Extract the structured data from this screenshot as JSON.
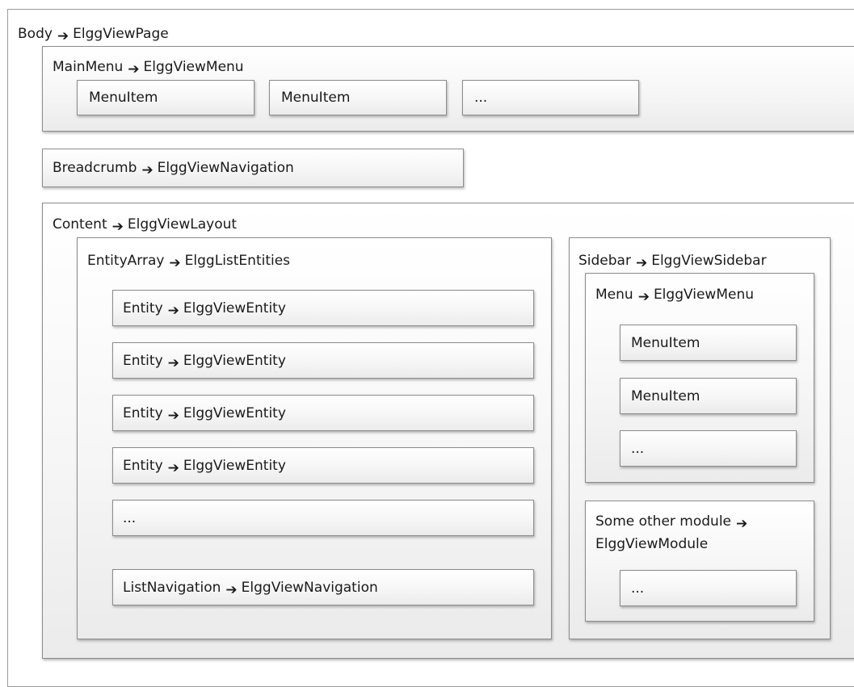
{
  "arrow": "➔",
  "body": {
    "name": "Body",
    "view": "ElggViewPage"
  },
  "main_menu": {
    "name": "MainMenu",
    "view": "ElggViewMenu",
    "items": [
      "MenuItem",
      "MenuItem",
      "..."
    ]
  },
  "breadcrumb": {
    "name": "Breadcrumb",
    "view": "ElggViewNavigation"
  },
  "content": {
    "name": "Content",
    "view": "ElggViewLayout"
  },
  "entity_array": {
    "name": "EntityArray",
    "view": "ElggListEntities",
    "entities": [
      {
        "name": "Entity",
        "view": "ElggViewEntity"
      },
      {
        "name": "Entity",
        "view": "ElggViewEntity"
      },
      {
        "name": "Entity",
        "view": "ElggViewEntity"
      },
      {
        "name": "Entity",
        "view": "ElggViewEntity"
      }
    ],
    "more": "...",
    "list_navigation": {
      "name": "ListNavigation",
      "view": "ElggViewNavigation"
    }
  },
  "sidebar": {
    "name": "Sidebar",
    "view": "ElggViewSidebar",
    "menu": {
      "name": "Menu",
      "view": "ElggViewMenu",
      "items": [
        "MenuItem",
        "MenuItem",
        "..."
      ]
    },
    "module": {
      "name": "Some other module",
      "view": "ElggViewModule",
      "item": "..."
    }
  }
}
